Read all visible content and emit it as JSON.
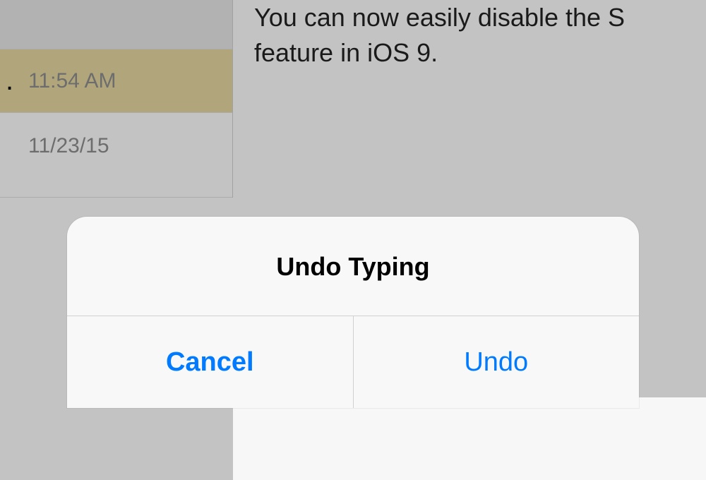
{
  "sidebar": {
    "item1_time": "11:54 AM",
    "item2_date": "11/23/15"
  },
  "note": {
    "text": "You can now easily disable the S feature in iOS 9."
  },
  "alert": {
    "title": "Undo Typing",
    "cancel_label": "Cancel",
    "undo_label": "Undo"
  }
}
